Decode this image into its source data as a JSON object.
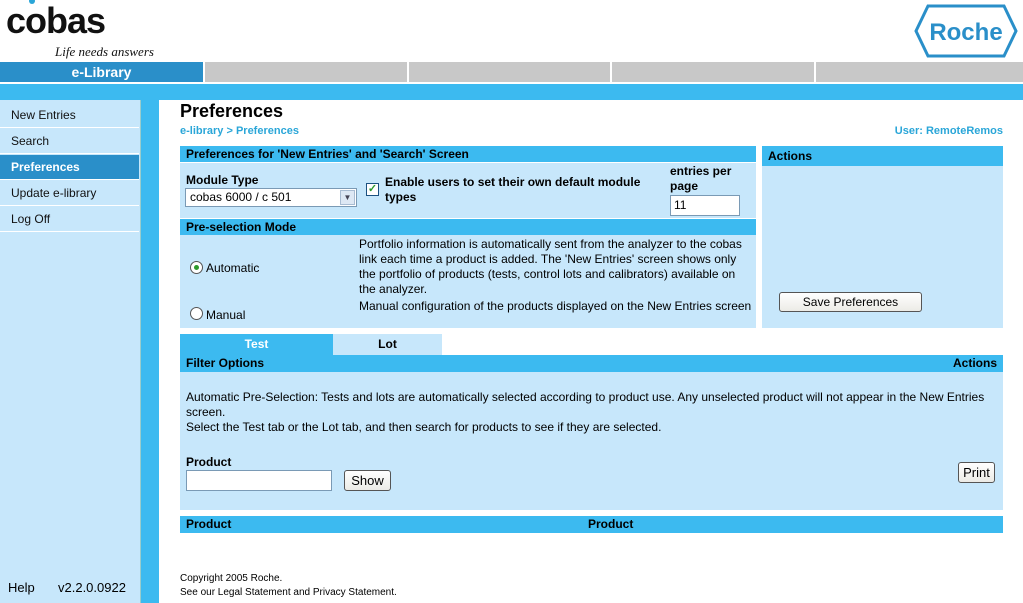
{
  "brand": {
    "name_pre": "c",
    "name_o": "o",
    "name_post": "bas",
    "tagline": "Life needs answers",
    "partner": "Roche"
  },
  "topnav": {
    "active_tab": "e-Library"
  },
  "sidebar": {
    "items": [
      {
        "label": "New Entries"
      },
      {
        "label": "Search"
      },
      {
        "label": "Preferences"
      },
      {
        "label": "Update e-library"
      },
      {
        "label": "Log Off"
      }
    ],
    "help": "Help",
    "version": "v2.2.0.0922"
  },
  "main": {
    "title": "Preferences",
    "breadcrumb": "e-library > Preferences",
    "user": "User: RemoteRemos"
  },
  "prefs": {
    "header": "Preferences for 'New Entries' and 'Search' Screen",
    "module_type_label": "Module Type",
    "module_type_value": "cobas 6000 / c 501",
    "checkbox_label": "Enable users to set their own default module types",
    "entries_label": "entries per page",
    "entries_value": "11"
  },
  "preselection": {
    "header": "Pre-selection Mode",
    "automatic_label": "Automatic",
    "automatic_desc": "Portfolio information is automatically sent from the analyzer to the cobas link each time a product is added. The 'New Entries' screen shows only the portfolio of products (tests, control lots and calibrators) available on the analyzer.",
    "manual_label": "Manual",
    "manual_desc": "Manual configuration of the products displayed on the New Entries screen"
  },
  "actions": {
    "header": "Actions",
    "save_label": "Save Preferences"
  },
  "tabs": [
    {
      "label": "Test"
    },
    {
      "label": "Lot"
    }
  ],
  "filter": {
    "header": "Filter Options",
    "actions": "Actions",
    "text": "Automatic Pre-Selection: Tests and lots are automatically selected according to product use. Any unselected product will not appear in the New Entries screen.",
    "text2": "Select the Test tab or the Lot tab, and then search for products to see if they are selected.",
    "product_label": "Product",
    "show_label": "Show",
    "print_label": "Print"
  },
  "results": {
    "col1": "Product",
    "col2": "Product"
  },
  "footer": {
    "copyright": "Copyright 2005 Roche.",
    "legal": "See our Legal Statement and Privacy Statement."
  }
}
